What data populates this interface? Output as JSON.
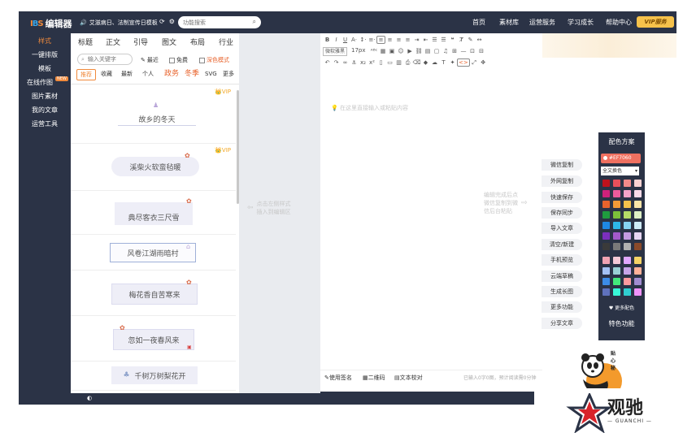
{
  "app": {
    "logo_mark": "IBS",
    "logo_text": "编辑器",
    "notice": "艾滋病日、法制宣传日模板",
    "search_placeholder": "功能搜索",
    "nav": [
      "首页",
      "素材库",
      "运营服务",
      "学习成长",
      "帮助中心"
    ],
    "vip_label": "VIP服务"
  },
  "leftnav": {
    "items": [
      "样式",
      "一键排版",
      "模板",
      "在线作图",
      "图片素材",
      "我的文章",
      "运营工具"
    ],
    "new_badge": "NEW"
  },
  "stylepanel": {
    "categories": [
      "标题",
      "正文",
      "引导",
      "图文",
      "布局",
      "行业"
    ],
    "keyword_placeholder": "输入关键字",
    "filters": [
      "最近",
      "免费",
      "深色模式"
    ],
    "subtabs": [
      "推荐",
      "收藏",
      "最新",
      "个人",
      "政务",
      "冬季",
      "SVG",
      "更多"
    ],
    "vip_tag": "VIP",
    "cards": [
      "故乡的冬天",
      "溪柴火软蛮毡暖",
      "典尽客衣三尺雪",
      "风卷江湖雨暗村",
      "梅花香自苦寒来",
      "忽如一夜春风来",
      "千树万树梨花开"
    ]
  },
  "editor": {
    "font_select": "微软雅黑",
    "size_select": "17px",
    "placeholder": "在这里直接输入或粘贴内容",
    "left_hint": [
      "点击左侧样式",
      "插入到编辑区"
    ],
    "right_hint": [
      "编辑完成后点",
      "微信复制到微",
      "信后台粘贴"
    ],
    "footer": [
      "使用签名",
      "二维码",
      "文本校对"
    ],
    "count": "已输入0字0图，预计阅读需0分钟"
  },
  "actions": [
    "微信复制",
    "外网复制",
    "快速保存",
    "保存同步",
    "导入文章",
    "清空/新建",
    "手机预览",
    "云端草稿",
    "生成长图",
    "更多功能",
    "分享文章"
  ],
  "colorpanel": {
    "title": "配色方案",
    "current": "#EF7060",
    "mode": "全文换色",
    "more": "♥ 更多配色",
    "special": "特色功能",
    "swatches": [
      "#c0121c",
      "#e8505b",
      "#f28a8a",
      "#fbd3d3",
      "#d0217b",
      "#ec5b9c",
      "#f5a3c8",
      "#fbdbe9",
      "#e8632c",
      "#f39a37",
      "#f6c24b",
      "#fbe5a8",
      "#1f9c3e",
      "#7cc13a",
      "#b5dc67",
      "#def1c6",
      "#1e88e5",
      "#2eb7e8",
      "#86d3f2",
      "#cfecf8",
      "#7b2fbe",
      "#a35ac9",
      "#c49be0",
      "#e7d6f3",
      "#3a3a3a",
      "#7a7a7a",
      "#b0b0b0",
      "#8a4a2a",
      "#f0a3b3",
      "#f4c9d6",
      "#e1a7ff",
      "#f6d365",
      "#a4c2f4",
      "#9ad1d4",
      "#c7a4e8",
      "#ffb199",
      "#3c8ce7",
      "#43e97b",
      "#ff9a9e",
      "#a18cd1",
      "#5f72bd",
      "#38f9d7",
      "#30cfd0",
      "#f093fb"
    ]
  },
  "mascot_text": "贴心秘",
  "brand": {
    "name": "观驰",
    "sub": "— GUANCHI —"
  }
}
